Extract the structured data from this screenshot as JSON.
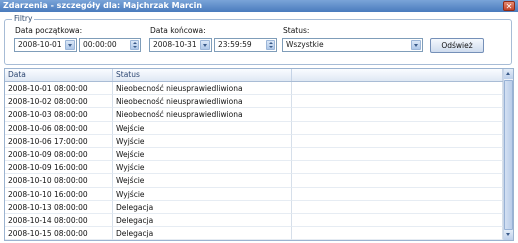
{
  "window": {
    "title": "Zdarzenia - szczegóły dla: Majchrzak Marcin",
    "close_glyph": "✕"
  },
  "filters": {
    "group_label": "Filtry",
    "start_label": "Data początkowa:",
    "start_date": "2008-10-01",
    "start_time": "00:00:00",
    "end_label": "Data końcowa:",
    "end_date": "2008-10-31",
    "end_time": "23:59:59",
    "status_label": "Status:",
    "status_value": "Wszystkie",
    "refresh_label": "Odśwież"
  },
  "grid": {
    "columns": [
      "Data",
      "Status",
      ""
    ],
    "rows": [
      {
        "date": "2008-10-01 08:00:00",
        "status": "Nieobecność nieusprawiedliwiona"
      },
      {
        "date": "2008-10-02 08:00:00",
        "status": "Nieobecność nieusprawiedliwiona"
      },
      {
        "date": "2008-10-03 08:00:00",
        "status": "Nieobecność nieusprawiedliwiona"
      },
      {
        "date": "2008-10-06 08:00:00",
        "status": "Wejście"
      },
      {
        "date": "2008-10-06 17:00:00",
        "status": "Wyjście"
      },
      {
        "date": "2008-10-09 08:00:00",
        "status": "Wejście"
      },
      {
        "date": "2008-10-09 16:00:00",
        "status": "Wyjście"
      },
      {
        "date": "2008-10-10 08:00:00",
        "status": "Wejście"
      },
      {
        "date": "2008-10-10 16:00:00",
        "status": "Wyjście"
      },
      {
        "date": "2008-10-13 08:00:00",
        "status": "Delegacja"
      },
      {
        "date": "2008-10-14 08:00:00",
        "status": "Delegacja"
      },
      {
        "date": "2008-10-15 08:00:00",
        "status": "Delegacja"
      }
    ]
  }
}
